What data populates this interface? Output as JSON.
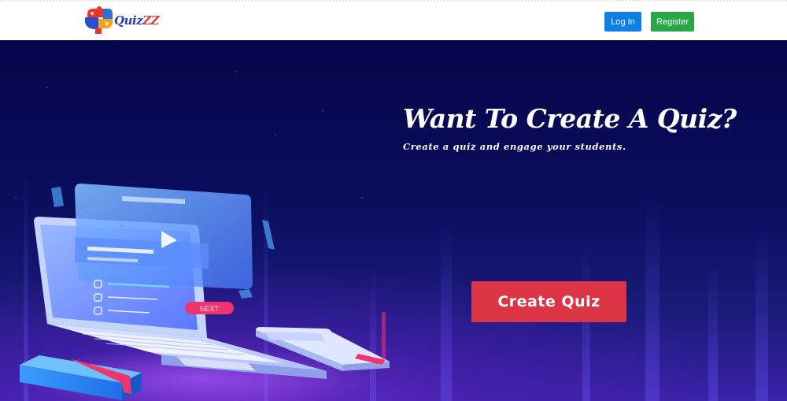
{
  "navbar": {
    "logo_text_main": "Quiz",
    "logo_text_accent": "ZZ",
    "login_label": "Log In",
    "register_label": "Register"
  },
  "hero": {
    "title": "Want To Create A Quiz?",
    "subtitle": "Create a quiz and engage your students.",
    "cta_label": "Create Quiz",
    "illustration": {
      "next_label": "NEXT"
    }
  },
  "colors": {
    "login": "#0d7fe8",
    "register": "#27a745",
    "cta": "#dc3545",
    "hero_bg": "#0b0d5e",
    "accent_pink": "#f0356e"
  }
}
